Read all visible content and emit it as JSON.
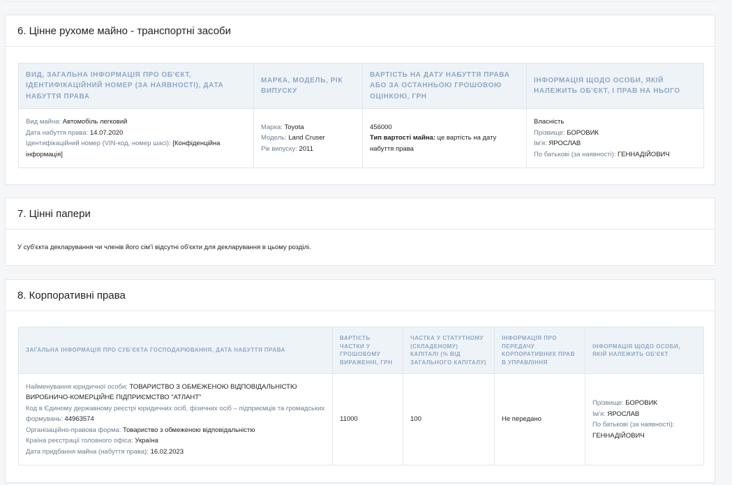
{
  "section6": {
    "title": "6. Цінне рухоме майно - транспортні засоби",
    "headers": [
      "Вид, загальна інформація про об'єкт, ідентифікаційний номер (за наявності), дата набуття права",
      "Марка, модель, рік випуску",
      "Вартість на дату набуття права або за останньою грошовою оцінкою, грн",
      "Інформація щодо особи, якій належить об'єкт, і прав на нього"
    ],
    "row": {
      "c1": {
        "type_label": "Вид майна: ",
        "type_value": "Автомобіль легковий",
        "date_label": "Дата набуття права: ",
        "date_value": "14.07.2020",
        "id_label": "Ідентифікаційний номер (VIN-код, номер шасі): ",
        "id_value": "[Конфіденційна інформація]"
      },
      "c2": {
        "brand_label": "Марка: ",
        "brand_value": "Toyota",
        "model_label": "Модель: ",
        "model_value": "Land Cruser",
        "year_label": "Рік випуску: ",
        "year_value": "2011"
      },
      "c3": {
        "value": "456000",
        "cost_type_label": "Тип вартості майна: ",
        "cost_type_value": "це вартість на дату набуття права"
      },
      "c4": {
        "right": "Власність",
        "surname_label": "Прізвище: ",
        "surname_value": "БОРОВИК",
        "name_label": "Ім'я: ",
        "name_value": "ЯРОСЛАВ",
        "patronymic_label": "По батькові (за наявності): ",
        "patronymic_value": "ГЕННАДІЙОВИЧ"
      }
    }
  },
  "section7": {
    "title": "7. Цінні папери",
    "note": "У суб'єкта декларування чи членів його сім'ї відсутні об'єкти для декларування в цьому розділі."
  },
  "section8": {
    "title": "8. Корпоративні права",
    "headers": [
      "Загальна інформація про суб'єкта господарювання, дата набуття права",
      "Вартість частки у грошовому вираженні, грн",
      "Частка у статутному (складеному) капіталі (% від загального капіталу)",
      "Інформація про передачу корпоративних прав в управління",
      "Інформація щодо особи, якій належить об'єкт"
    ],
    "row": {
      "c1": {
        "name_label": "Найменування юридичної особи: ",
        "name_value": "ТОВАРИСТВО З ОБМЕЖЕНОЮ ВІДПОВІДАЛЬНІСТЮ ВИРОБНИЧО-КОМЕРЦІЙНЕ ПІДПРИЄМСТВО \"АТЛАНТ\"",
        "code_label": "Код в Єдиному державному реєстрі юридичних осіб, фізичних осіб – підприємців та громадських формувань: ",
        "code_value": "44963574",
        "form_label": "Організаційно-правова форма: ",
        "form_value": "Товариство з обмеженою відповідальністю",
        "country_label": "Країна реєстрації головного офіса: ",
        "country_value": "Україна",
        "date_label": "Дата придбання майна (набуття права): ",
        "date_value": "16.02.2023"
      },
      "c2": "11000",
      "c3": "100",
      "c4": "Не передано",
      "c5": {
        "surname_label": "Прізвище: ",
        "surname_value": "БОРОВИК",
        "name_label": "Ім'я: ",
        "name_value": "ЯРОСЛАВ",
        "patronymic_label": "По батькові (за наявності): ",
        "patronymic_value": "ГЕННАДІЙОВИЧ"
      }
    }
  }
}
